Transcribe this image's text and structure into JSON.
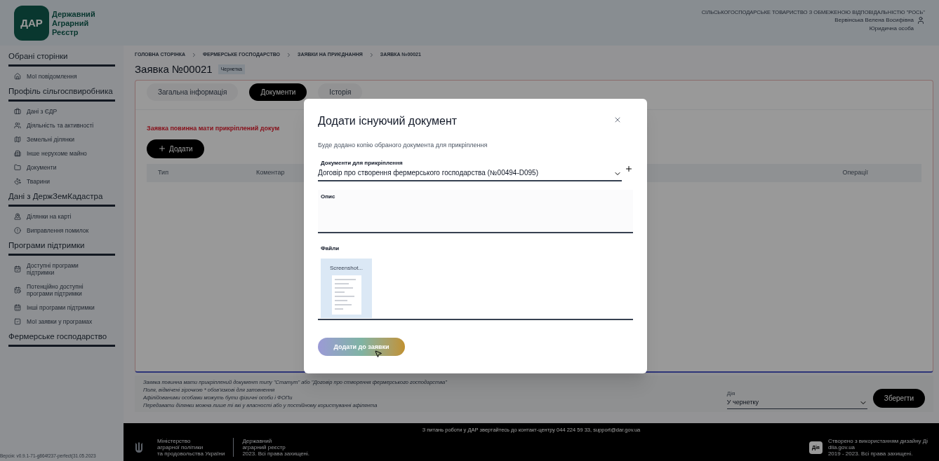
{
  "header": {
    "logo_mark": "ДАР",
    "logo_text": [
      "Державний",
      "Аграрний",
      "Реєстр"
    ],
    "organization": "СІЛЬСЬКОГОСПОДАРСЬКЕ ТОВАРИСТВО З ОБМЕЖЕНОЮ ВІДПОВІДАЛЬНІСТЮ \"РОСЬ\"",
    "user": "Вервінська Велена Восифівна",
    "role": "Юридична особа"
  },
  "sidebar": {
    "sections": [
      {
        "title": "Обрані сторінки",
        "items": [
          {
            "label": "Мої повідомлення"
          }
        ]
      },
      {
        "title": "Профіль сільгоспвиробника",
        "items": [
          {
            "label": "Дані з ЄДР"
          },
          {
            "label": "Діяльність та активності"
          },
          {
            "label": "Земельні ділянки"
          },
          {
            "label": "Інше нерухоме майно"
          },
          {
            "label": "Документи"
          },
          {
            "label": "Тварини"
          }
        ]
      },
      {
        "title": "Дані з ДержЗемКадастра",
        "items": [
          {
            "label": "Ділянки на карті"
          },
          {
            "label": "Виправлення помилок"
          }
        ]
      },
      {
        "title": "Програми підтримки",
        "items": [
          {
            "label": "Доступні програми підтримки"
          },
          {
            "label": "Потенційно доступні програми підтримки"
          },
          {
            "label": "Інші програми підтримки"
          },
          {
            "label": "Мої заявки у програмах"
          }
        ]
      },
      {
        "title": "Фермерське господарство"
      }
    ],
    "version": "Версія: v0.9.1-71-g864f237-perfect(31.05.2023"
  },
  "breadcrumbs": [
    "ГОЛОВНА СТОРІНКА",
    "ФЕРМЕРСЬКЕ ГОСПОДАРСТВО",
    "ЗАЯВКИ НА ПРИЄДНАННЯ",
    "ЗАЯВКА №00021"
  ],
  "title": "Заявка №00021",
  "status_badge": "Чернетка",
  "tabs": [
    {
      "label": "Загальна інформація",
      "selected": false
    },
    {
      "label": "Документи",
      "selected": true
    },
    {
      "label": "Історія",
      "selected": false
    }
  ],
  "warning": "Заявка повинна мати прикріплений докум",
  "add_button": "Додати",
  "table": {
    "columns": [
      "Тип",
      "Коментар",
      "Операції"
    ]
  },
  "notes": [
    "Заявка повинна мати прикріплений документ типу \"Статут\" або \"Договір про створення фермерського господарства\"",
    "Поля, відмічені зірочкою * обов'язкові для заповнення",
    "Афілійованими особами можуть бути фізичні особи і ФОПи",
    "Передавати ділянки можна лише ті які у власності або у постійному користуванні афілянта"
  ],
  "action": {
    "label": "Дія",
    "value": "У чернетку",
    "button": "Зберегти"
  },
  "footer": {
    "contact": "З питань роботи у ДАР звертайтесь до контакт-центру 044 224 59 33, support@dar.gov.ua",
    "ministry": [
      "Міністерство",
      "аграрної політики",
      "та продовольства України"
    ],
    "registry": [
      "Державний",
      "аграрний реєстр",
      "2023. Всі права захищені."
    ],
    "diia_badge": "Дія",
    "diia": [
      "Створено з використанням дизайну Ді",
      "diia.gov.ua",
      "2019 - 2023. Всі права захищені."
    ]
  },
  "modal": {
    "title": "Додати існуючий документ",
    "subtitle": "Буде додано копію обраного документа для прикріплення",
    "document_field": {
      "label": "Документи для прикріплення",
      "value": "Договір про створення фермерського господарства (№00494-D095)"
    },
    "description_field": {
      "label": "Опис"
    },
    "files": {
      "label": "Файли",
      "items": [
        {
          "name": "Screenshot..."
        }
      ]
    },
    "submit": "Додати до заявки"
  }
}
